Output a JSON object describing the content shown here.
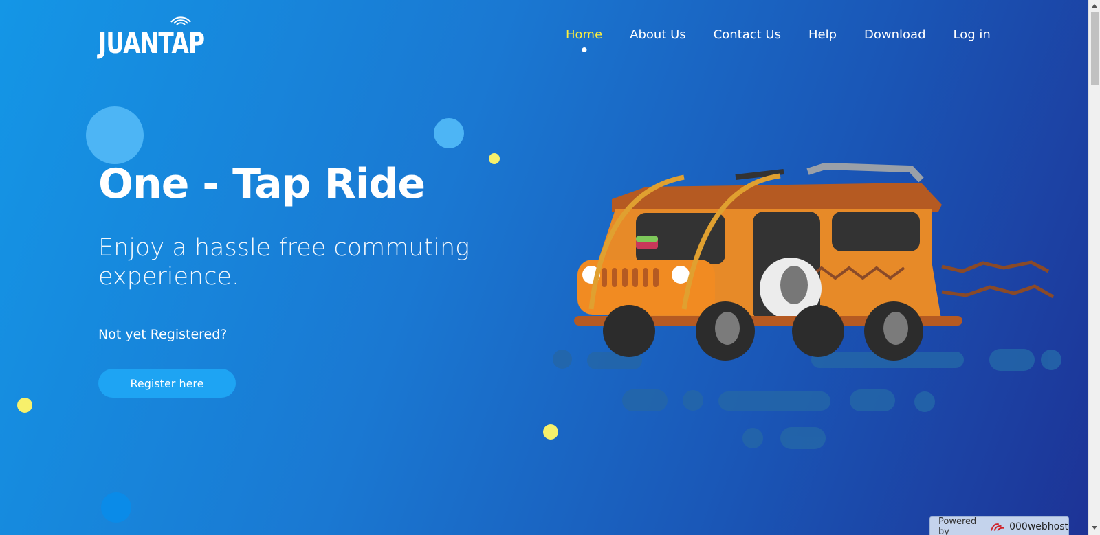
{
  "logo": {
    "text": "JUANTAP"
  },
  "nav": {
    "items": [
      {
        "label": "Home",
        "active": true
      },
      {
        "label": "About Us",
        "active": false
      },
      {
        "label": "Contact Us",
        "active": false
      },
      {
        "label": "Help",
        "active": false
      },
      {
        "label": "Download",
        "active": false
      },
      {
        "label": "Log in",
        "active": false
      }
    ]
  },
  "hero": {
    "title": "One - Tap Ride",
    "subtitle": "Enjoy a hassle free commuting experience.",
    "prompt": "Not yet Registered?",
    "register_label": "Register here"
  },
  "footer": {
    "powered_label": "Powered by",
    "powered_brand": "000webhost"
  },
  "colors": {
    "background_start": "#1496e6",
    "background_end": "#1d3396",
    "active_nav": "#ffef3c",
    "register_button": "#1ea4f3",
    "jeepney_body": "#f08a24"
  },
  "icons": [
    "nfc-tap-icon",
    "jeepney-illustration",
    "000webhost-logo-icon"
  ]
}
